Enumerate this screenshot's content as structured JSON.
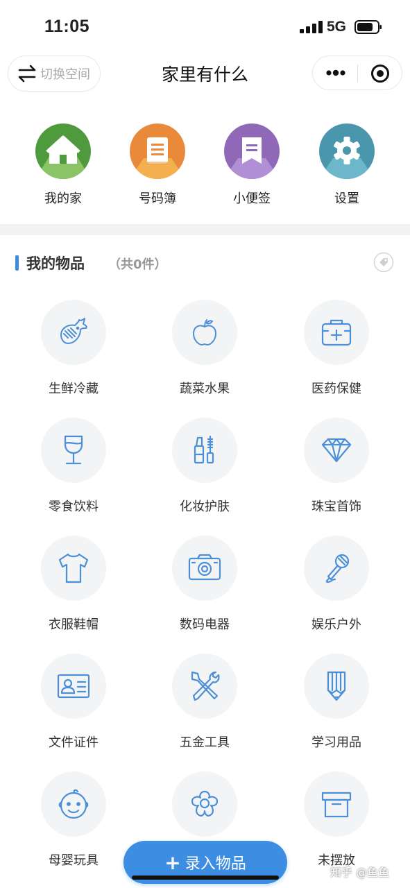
{
  "status_bar": {
    "time": "11:05",
    "network": "5G"
  },
  "nav": {
    "switch_label": "切换空间",
    "title": "家里有什么"
  },
  "quick_entries": [
    {
      "label": "我的家",
      "icon": "home-icon",
      "color": "#4f9a3c"
    },
    {
      "label": "号码簿",
      "icon": "book-icon",
      "color": "#e98a3a"
    },
    {
      "label": "小便签",
      "icon": "note-icon",
      "color": "#8f68b8"
    },
    {
      "label": "设置",
      "icon": "gear-icon",
      "color": "#4a97ad"
    }
  ],
  "section": {
    "title": "我的物品",
    "count": "（共0件）"
  },
  "categories": [
    {
      "label": "生鲜冷藏",
      "icon": "fish-icon"
    },
    {
      "label": "蔬菜水果",
      "icon": "apple-icon"
    },
    {
      "label": "医药保健",
      "icon": "medkit-icon"
    },
    {
      "label": "零食饮料",
      "icon": "wine-glass-icon"
    },
    {
      "label": "化妆护肤",
      "icon": "lipstick-icon"
    },
    {
      "label": "珠宝首饰",
      "icon": "diamond-icon"
    },
    {
      "label": "衣服鞋帽",
      "icon": "tshirt-icon"
    },
    {
      "label": "数码电器",
      "icon": "camera-icon"
    },
    {
      "label": "娱乐户外",
      "icon": "microphone-icon"
    },
    {
      "label": "文件证件",
      "icon": "id-card-icon"
    },
    {
      "label": "五金工具",
      "icon": "tools-icon"
    },
    {
      "label": "学习用品",
      "icon": "pencil-icon"
    },
    {
      "label": "母婴玩具",
      "icon": "baby-icon"
    },
    {
      "label": "",
      "icon": "flower-icon"
    },
    {
      "label": "未摆放",
      "icon": "box-icon"
    }
  ],
  "add_button": {
    "label": "录入物品"
  },
  "watermark": "知乎 @鱼鱼",
  "colors": {
    "accent": "#3d8ee3",
    "icon_blue": "#4a8fd8"
  }
}
